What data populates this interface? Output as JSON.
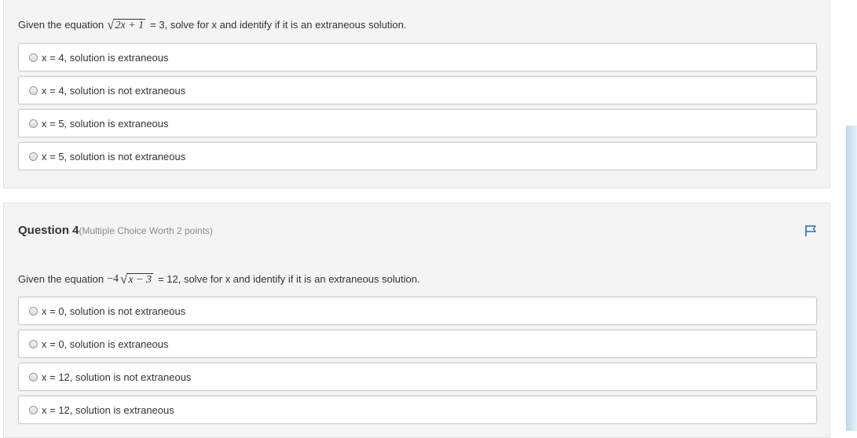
{
  "question3": {
    "prompt_before": "Given the equation",
    "equation_radicand": "2x + 1",
    "prompt_after": "= 3, solve for x and identify if it is an extraneous solution.",
    "options": [
      "x = 4, solution is extraneous",
      "x = 4, solution is not extraneous",
      "x = 5, solution is extraneous",
      "x = 5, solution is not extraneous"
    ]
  },
  "question4": {
    "title": "Question 4",
    "points": "(Multiple Choice Worth 2 points)",
    "prompt_before": "Given the equation",
    "equation_coefficient": "−4",
    "equation_radicand": "x − 3",
    "prompt_after": "= 12, solve for x and identify if it is an extraneous solution.",
    "options": [
      "x = 0, solution is not extraneous",
      "x = 0, solution is extraneous",
      "x = 12, solution is not extraneous",
      "x = 12, solution is extraneous"
    ]
  },
  "icons": {
    "flag": "flag-icon",
    "radio": "radio-icon"
  },
  "colors": {
    "flag": "#2a6fb0",
    "scrollbar": "#bcd7ea"
  }
}
